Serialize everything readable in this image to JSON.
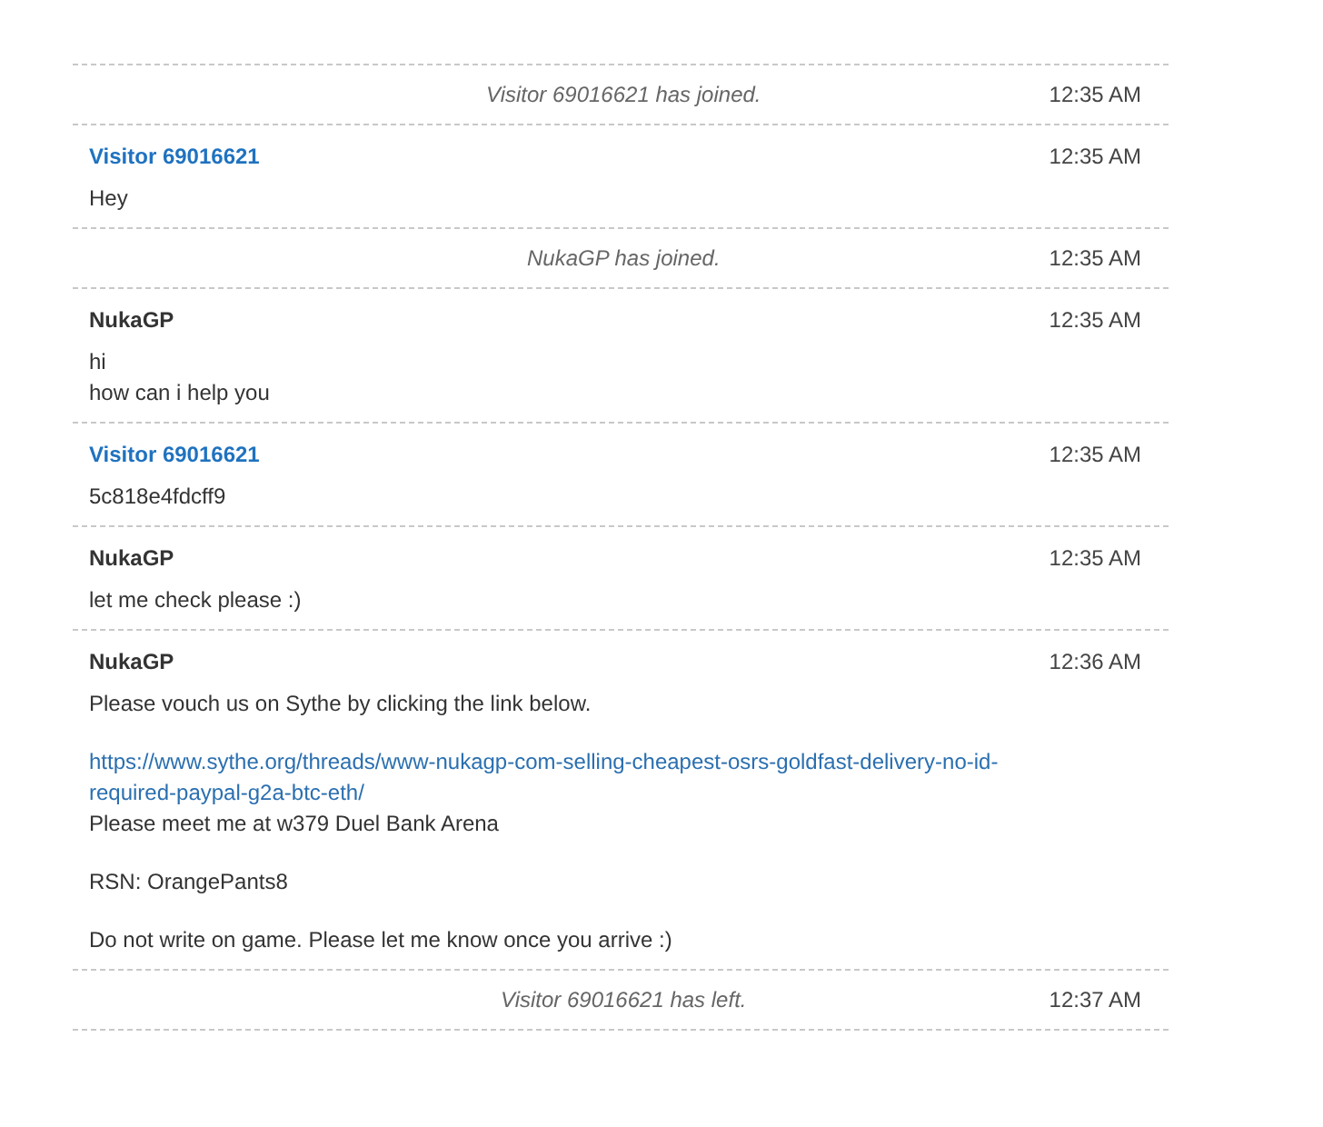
{
  "transcript": [
    {
      "kind": "event",
      "text": "Visitor 69016621 has joined.",
      "time": "12:35 AM"
    },
    {
      "kind": "message",
      "sender": "Visitor 69016621",
      "color": "#1f72c0",
      "time": "12:35 AM",
      "paragraphs": [
        {
          "lines": [
            {
              "kind": "text",
              "text": "Hey"
            }
          ]
        }
      ]
    },
    {
      "kind": "event",
      "text": "NukaGP has joined.",
      "time": "12:35 AM"
    },
    {
      "kind": "message",
      "sender": "NukaGP",
      "color": "#333333",
      "time": "12:35 AM",
      "paragraphs": [
        {
          "lines": [
            {
              "kind": "text",
              "text": "hi"
            },
            {
              "kind": "text",
              "text": "how can i help you"
            }
          ]
        }
      ]
    },
    {
      "kind": "message",
      "sender": "Visitor 69016621",
      "color": "#1f72c0",
      "time": "12:35 AM",
      "paragraphs": [
        {
          "lines": [
            {
              "kind": "text",
              "text": "5c818e4fdcff9"
            }
          ]
        }
      ]
    },
    {
      "kind": "message",
      "sender": "NukaGP",
      "color": "#333333",
      "time": "12:35 AM",
      "paragraphs": [
        {
          "lines": [
            {
              "kind": "text",
              "text": "let me check please :)"
            }
          ]
        }
      ]
    },
    {
      "kind": "message",
      "sender": "NukaGP",
      "color": "#333333",
      "time": "12:36 AM",
      "paragraphs": [
        {
          "lines": [
            {
              "kind": "text",
              "text": "Please vouch us on Sythe by clicking the link below."
            }
          ]
        },
        {
          "lines": [
            {
              "kind": "link",
              "text": "https://www.sythe.org/threads/www-nukagp-com-selling-cheapest-osrs-goldfast-delivery-no-id-required-paypal-g2a-btc-eth/"
            },
            {
              "kind": "text",
              "text": "Please meet me at w379 Duel Bank Arena"
            }
          ]
        },
        {
          "lines": [
            {
              "kind": "text",
              "text": "RSN: OrangePants8"
            }
          ]
        },
        {
          "lines": [
            {
              "kind": "text",
              "text": "Do not write on game. Please let me know once you arrive :)"
            }
          ]
        }
      ]
    },
    {
      "kind": "event",
      "text": "Visitor 69016621 has left.",
      "time": "12:37 AM"
    }
  ]
}
